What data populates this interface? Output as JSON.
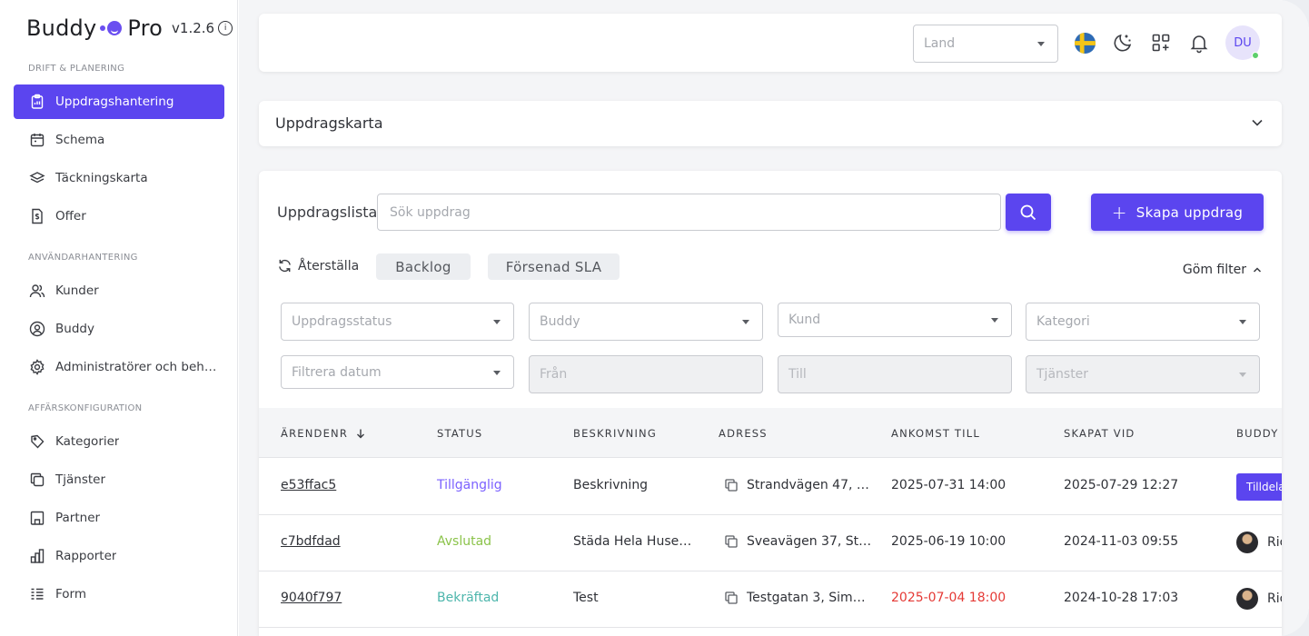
{
  "brand": {
    "name_left": "Buddy",
    "name_right": "Pro",
    "version": "v1.2.6",
    "info_glyph": "i"
  },
  "sidebar": {
    "sections": [
      {
        "label": "DRIFT & PLANERING"
      },
      {
        "label": "ANVÄNDARHANTERING"
      },
      {
        "label": "AFFÄRSKONFIGURATION"
      }
    ],
    "items": [
      {
        "label": "Uppdragshantering",
        "icon": "clipboard-icon"
      },
      {
        "label": "Schema",
        "icon": "calendar-icon"
      },
      {
        "label": "Täckningskarta",
        "icon": "layers-icon"
      },
      {
        "label": "Offer",
        "icon": "dollar-document-icon"
      },
      {
        "label": "Kunder",
        "icon": "users-icon"
      },
      {
        "label": "Buddy",
        "icon": "user-circle-icon"
      },
      {
        "label": "Administratörer och beh…",
        "icon": "gear-icon"
      },
      {
        "label": "Kategorier",
        "icon": "tag-icon"
      },
      {
        "label": "Tjänster",
        "icon": "copy-icon"
      },
      {
        "label": "Partner",
        "icon": "building-icon"
      },
      {
        "label": "Rapporter",
        "icon": "bar-chart-icon"
      },
      {
        "label": "Form",
        "icon": "list-icon"
      }
    ]
  },
  "topbar": {
    "country_placeholder": "Land",
    "avatar_initials": "DU"
  },
  "map": {
    "title": "Uppdragskarta"
  },
  "list": {
    "title": "Uppdragslista",
    "search_placeholder": "Sök uppdrag",
    "create_label": "Skapa uppdrag",
    "create_plus": "+",
    "reset_label": "Återställa",
    "chips": [
      "Backlog",
      "Försenad SLA"
    ],
    "hide_filter_label": "Göm filter",
    "filters": {
      "status": "Uppdragsstatus",
      "buddy": "Buddy",
      "customer": "Kund",
      "category": "Kategori",
      "date": "Filtrera datum",
      "from": "Från",
      "to": "Till",
      "services": "Tjänster"
    },
    "columns": [
      "ÄRENDENR",
      "STATUS",
      "BESKRIVNING",
      "ADRESS",
      "ANKOMST TILL",
      "SKAPAT VID",
      "BUDDY"
    ],
    "rows": [
      {
        "id": "e53ffac5",
        "status": "Tillgänglig",
        "description": "Beskrivning",
        "address": "Strandvägen 47, …",
        "arrival": "2025-07-31 14:00",
        "created": "2025-07-29 12:27",
        "buddy": "Tilldela"
      },
      {
        "id": "c7bdfdad",
        "status": "Avslutad",
        "description": "Städa Hela Huse…",
        "address": "Sveavägen 37, St…",
        "arrival": "2025-06-19 10:00",
        "created": "2024-11-03 09:55",
        "buddy": "Ric"
      },
      {
        "id": "9040f797",
        "status": "Bekräftad",
        "description": "Test",
        "address": "Testgatan 3, Sim…",
        "arrival": "2025-07-04 18:00",
        "created": "2024-10-28 17:03",
        "buddy": "Ric"
      }
    ]
  },
  "colors": {
    "accent": "#5b45ef",
    "status_available": "#7b61ff",
    "status_done": "#8bc34a",
    "status_confirmed": "#4db6ac",
    "overdue": "#e53935"
  }
}
